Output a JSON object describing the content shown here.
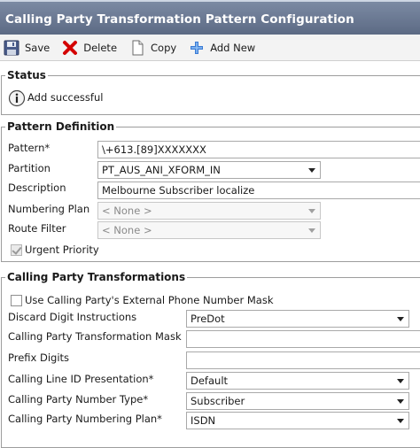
{
  "window": {
    "title": "Calling Party Transformation Pattern Configuration"
  },
  "toolbar": {
    "save": "Save",
    "delete": "Delete",
    "copy": "Copy",
    "add_new": "Add New"
  },
  "status": {
    "legend": "Status",
    "message": "Add successful"
  },
  "pattern_definition": {
    "legend": "Pattern Definition",
    "pattern_label": "Pattern*",
    "pattern_value": "\\+613.[89]XXXXXXX",
    "partition_label": "Partition",
    "partition_value": "PT_AUS_ANI_XFORM_IN",
    "description_label": "Description",
    "description_value": "Melbourne Subscriber localize",
    "numbering_plan_label": "Numbering Plan",
    "numbering_plan_value": "< None >",
    "route_filter_label": "Route Filter",
    "route_filter_value": "< None >",
    "urgent_priority_label": "Urgent Priority",
    "urgent_priority_checked": true
  },
  "transformations": {
    "legend": "Calling Party Transformations",
    "use_mask_label": "Use Calling Party's External Phone Number Mask",
    "use_mask_checked": false,
    "discard_label": "Discard Digit Instructions",
    "discard_value": "PreDot",
    "mask_label": "Calling Party Transformation Mask",
    "mask_value": "",
    "prefix_label": "Prefix Digits",
    "prefix_value": "",
    "clid_label": "Calling Line ID Presentation*",
    "clid_value": "Default",
    "number_type_label": "Calling Party Number Type*",
    "number_type_value": "Subscriber",
    "numbering_plan_label": "Calling Party Numbering Plan*",
    "numbering_plan_value": "ISDN"
  },
  "colors": {
    "title_bar": "#6b7993",
    "delete_icon": "#d40000",
    "add_icon": "#3a7bd5"
  }
}
